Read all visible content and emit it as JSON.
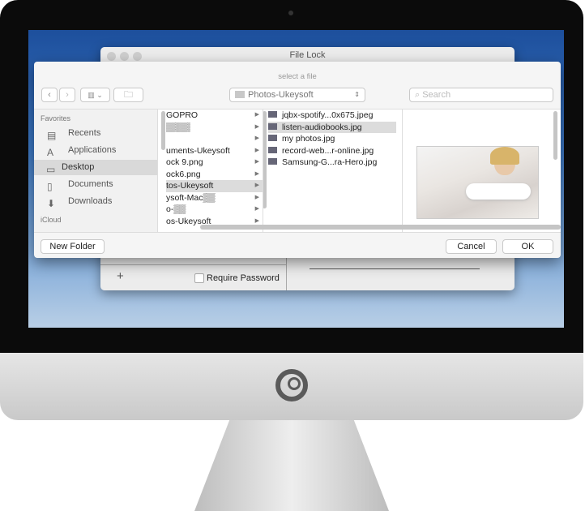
{
  "background_window": {
    "title": "File Lock",
    "add_label": "+",
    "require_password_label": "Require Password"
  },
  "dialog": {
    "prompt": "select a file",
    "location": "Photos-Ukeysoft",
    "search_placeholder": "Search",
    "sidebar": {
      "favorites_label": "Favorites",
      "items": [
        {
          "label": "Recents",
          "icon": "recents-icon"
        },
        {
          "label": "Applications",
          "icon": "applications-icon"
        },
        {
          "label": "Desktop",
          "icon": "desktop-icon",
          "selected": true
        },
        {
          "label": "Documents",
          "icon": "documents-icon"
        },
        {
          "label": "Downloads",
          "icon": "downloads-icon"
        }
      ],
      "icloud_label": "iCloud"
    },
    "column1": [
      {
        "label": "GOPRO"
      },
      {
        "label": "▒▒▒▒"
      },
      {
        "label": ""
      },
      {
        "label": "uments-Ukeysoft"
      },
      {
        "label": "ock 9.png"
      },
      {
        "label": "ock6.png"
      },
      {
        "label": "tos-Ukeysoft",
        "selected": true
      },
      {
        "label": "ysoft-Mac▒▒"
      },
      {
        "label": "o-▒▒"
      },
      {
        "label": "os-Ukeysoft"
      }
    ],
    "column2": [
      {
        "label": "jqbx-spotify...0x675.jpeg"
      },
      {
        "label": "listen-audiobooks.jpg",
        "selected": true
      },
      {
        "label": "my photos.jpg"
      },
      {
        "label": "record-web...r-online.jpg"
      },
      {
        "label": "Samsung-G...ra-Hero.jpg"
      }
    ],
    "new_folder_label": "New Folder",
    "cancel_label": "Cancel",
    "ok_label": "OK"
  }
}
